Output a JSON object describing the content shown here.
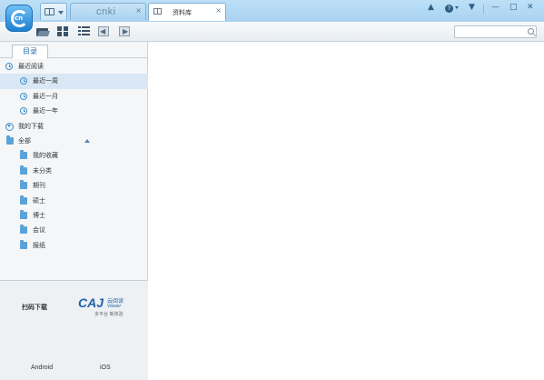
{
  "titlebar": {
    "cnki_tab_logo": "cnki",
    "library_tab_label": "资料库",
    "close_glyph": "×",
    "icons": [
      "user-icon",
      "help-icon",
      "skin-icon",
      "minimize-icon",
      "maximize-icon",
      "close-icon"
    ],
    "help_glyph": "?",
    "min_glyph": "—",
    "max_glyph": "□",
    "win_close_glyph": "✕"
  },
  "toolbar": {
    "icons": [
      "open-folder-icon",
      "grid-view-icon",
      "list-view-icon",
      "back-icon",
      "forward-icon"
    ],
    "search_placeholder": ""
  },
  "sidebar": {
    "tab_label": "目录",
    "recent": {
      "label": "最近阅读",
      "items": [
        {
          "label": "最近一周",
          "selected": true
        },
        {
          "label": "最近一月",
          "selected": false
        },
        {
          "label": "最近一年",
          "selected": false
        }
      ]
    },
    "downloads_label": "我的下载",
    "all": {
      "label": "全部",
      "items": [
        "我的收藏",
        "未分类",
        "期刊",
        "硕士",
        "博士",
        "会议",
        "报纸"
      ]
    }
  },
  "promo": {
    "scan_label": "扫码下载",
    "caj_logo": "CAJ",
    "caj_name": "云阅读",
    "caj_viewer": "Viewer",
    "caj_tagline": "多平台 新体验",
    "android_label": "Android",
    "ios_label": "iOS"
  },
  "colors": {
    "accent": "#3d8fcc",
    "titlebar": "#a9d3f1",
    "selected_row": "#d9e8f4",
    "brand_caj": "#1f62a8"
  }
}
